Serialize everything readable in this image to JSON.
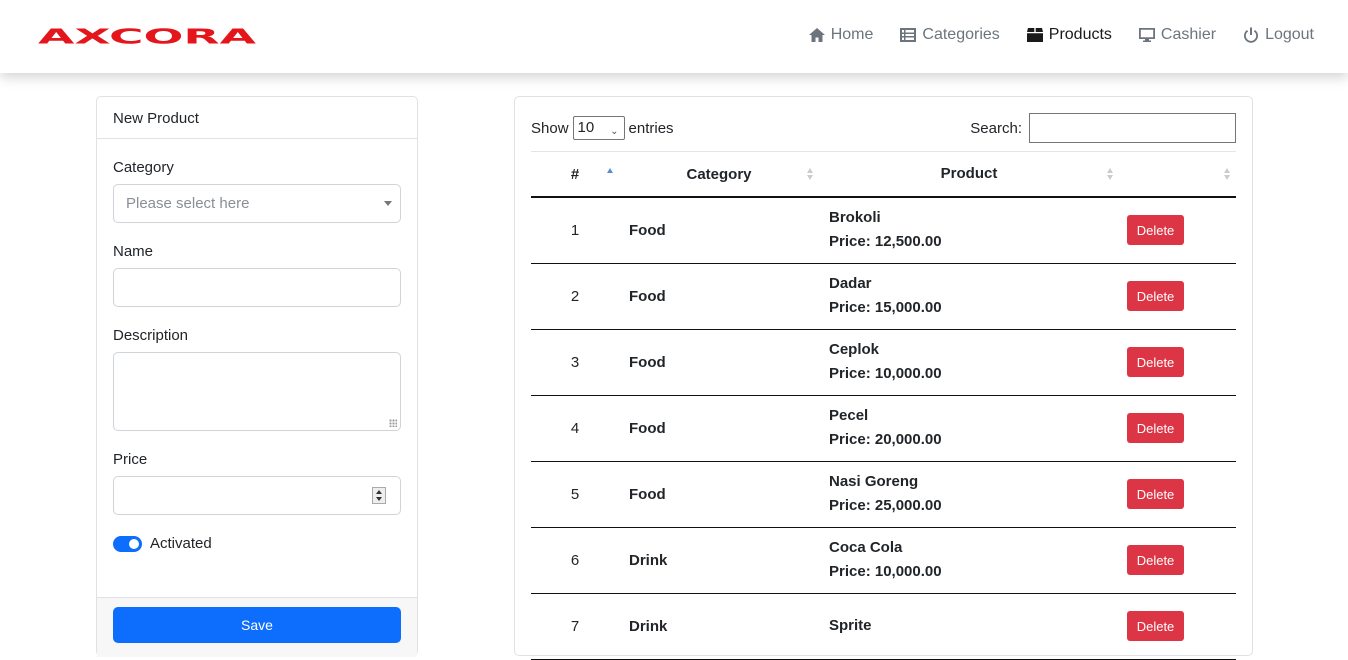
{
  "brand": {
    "name": "AXCORA",
    "color": "#e4151b"
  },
  "nav": {
    "items": [
      {
        "label": "Home",
        "icon": "home-icon",
        "active": false
      },
      {
        "label": "Categories",
        "icon": "list-icon",
        "active": false
      },
      {
        "label": "Products",
        "icon": "box-icon",
        "active": true
      },
      {
        "label": "Cashier",
        "icon": "monitor-icon",
        "active": false
      },
      {
        "label": "Logout",
        "icon": "power-icon",
        "active": false
      }
    ]
  },
  "form": {
    "title": "New Product",
    "category_label": "Category",
    "category_placeholder": "Please select here",
    "name_label": "Name",
    "name_value": "",
    "description_label": "Description",
    "description_value": "",
    "price_label": "Price",
    "price_value": "",
    "activated_label": "Activated",
    "activated": true,
    "save_label": "Save"
  },
  "table": {
    "show_label": "Show",
    "entries_value": "10",
    "entries_label": "entries",
    "search_label": "Search:",
    "search_value": "",
    "columns": [
      "#",
      "Category",
      "Product",
      ""
    ],
    "delete_label": "Delete",
    "rows": [
      {
        "num": "1",
        "category": "Food",
        "product": "Brokoli",
        "price": "Price: 12,500.00"
      },
      {
        "num": "2",
        "category": "Food",
        "product": "Dadar",
        "price": "Price: 15,000.00"
      },
      {
        "num": "3",
        "category": "Food",
        "product": "Ceplok",
        "price": "Price: 10,000.00"
      },
      {
        "num": "4",
        "category": "Food",
        "product": "Pecel",
        "price": "Price: 20,000.00"
      },
      {
        "num": "5",
        "category": "Food",
        "product": "Nasi Goreng",
        "price": "Price: 25,000.00"
      },
      {
        "num": "6",
        "category": "Drink",
        "product": "Coca Cola",
        "price": "Price: 10,000.00"
      },
      {
        "num": "7",
        "category": "Drink",
        "product": "Sprite",
        "price": ""
      }
    ]
  },
  "colors": {
    "primary": "#0d6efd",
    "danger": "#dc3545"
  }
}
